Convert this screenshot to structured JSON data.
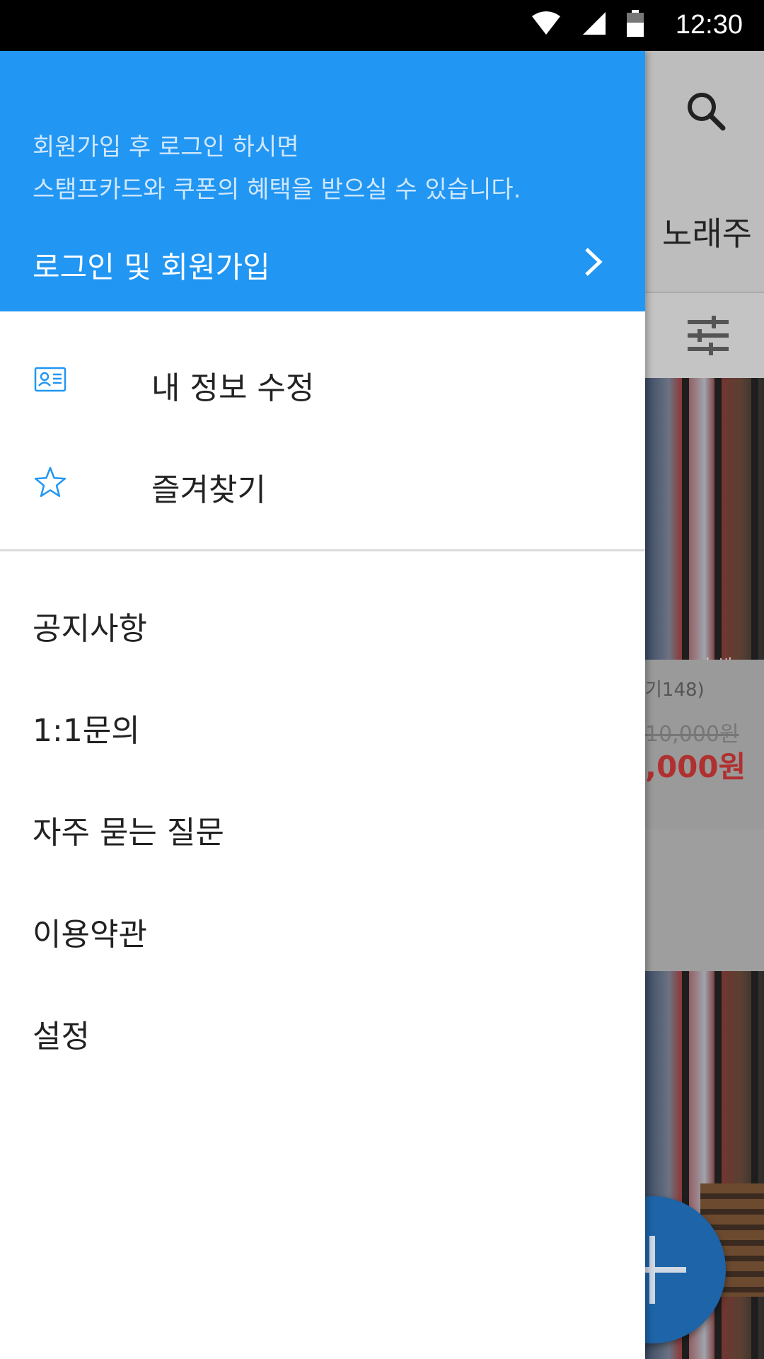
{
  "status_bar": {
    "time": "12:30",
    "icons": [
      "wifi-icon",
      "signal-icon",
      "battery-icon"
    ]
  },
  "background_app": {
    "title": "노래주",
    "count_text": "기148)",
    "old_price": "10,000원",
    "price": ",000원",
    "watermark": "놀방"
  },
  "drawer": {
    "header": {
      "message_line1": "회원가입 후 로그인 하시면",
      "message_line2": "스탬프카드와 쿠폰의 혜택을 받으실 수 있습니다.",
      "login_label": "로그인 및 회원가입"
    },
    "icon_items": [
      {
        "label": "내 정보 수정",
        "icon": "id-card-icon"
      },
      {
        "label": "즐겨찾기",
        "icon": "star-icon"
      }
    ],
    "plain_items": [
      {
        "label": "공지사항"
      },
      {
        "label": "1:1문의"
      },
      {
        "label": "자주 묻는 질문"
      },
      {
        "label": "이용약관"
      },
      {
        "label": "설정"
      }
    ]
  },
  "colors": {
    "accent": "#2196f3",
    "price_red": "#b03030",
    "fab": "#1d64a8"
  }
}
